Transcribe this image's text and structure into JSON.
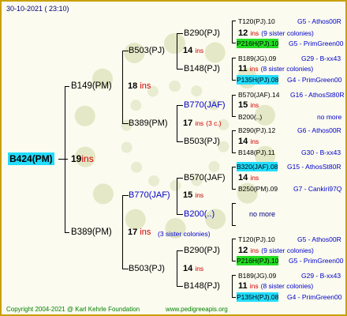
{
  "header": {
    "date_line": "30-10-2021 ( 23:10)"
  },
  "footer": {
    "copyright": "Copyright 2004-2021 @ Karl Kehrle Foundation",
    "site": "www.pedigreeapis.org"
  },
  "colors": {
    "frame": "#c8a000",
    "green_hl": "#22dd22",
    "cyan_hl": "#22ddff",
    "ins_red": "#d00000",
    "link_blue": "#0000cc"
  },
  "root": {
    "label": "B424(PM)",
    "gen": "19",
    "unit": "ins"
  },
  "g1": {
    "top": {
      "label": "B149(PM)",
      "gen": "18",
      "unit": "ins"
    },
    "bottom": {
      "label": "B389(PM)",
      "gen": "17",
      "unit": "ins",
      "note": "(3 sister colonies)"
    }
  },
  "g2": {
    "a": {
      "label": "B503(PJ)",
      "gen": "14",
      "unit": "ins"
    },
    "b": {
      "label": "B389(PM)",
      "gen": "17",
      "unit": "ins",
      "note": "(3 c.)"
    },
    "c": {
      "label": "B770(JAF)",
      "gen": "15",
      "unit": "ins"
    },
    "d": {
      "label": "B503(PJ)",
      "gen": "14",
      "unit": "ins"
    }
  },
  "g3": {
    "a1": {
      "label": "B290(PJ)",
      "gen": "12",
      "unit": "ins",
      "note": "(9 sister colonies)"
    },
    "a2": {
      "label": "B148(PJ)",
      "gen": "11",
      "unit": "ins",
      "note": "(8 sister colonies)"
    },
    "b1": {
      "label": "B770(JAF)",
      "gen": "15",
      "unit": "ins"
    },
    "b2": {
      "label": "B503(PJ)",
      "gen": "14",
      "unit": "ins"
    },
    "c1": {
      "label": "B570(JAF)",
      "gen": "14",
      "unit": "ins"
    },
    "c2": {
      "label": "B200(..)",
      "more": "no more"
    },
    "d1": {
      "label": "B290(PJ)",
      "gen": "12",
      "unit": "ins",
      "note": "(9 sister colonies)"
    },
    "d2": {
      "label": "B148(PJ)",
      "gen": "11",
      "unit": "ins",
      "note": "(8 sister colonies)"
    }
  },
  "g4": [
    {
      "name": "T120(PJ).10",
      "line": "G5 - Athos00R"
    },
    {
      "name": "P216H(PJ).10",
      "line": "G5 - PrimGreen00"
    },
    {
      "name": "B189(JG).09",
      "line": "G29 - B-xx43"
    },
    {
      "name": "P135H(PJ).08",
      "line": "G4 - PrimGreen00"
    },
    {
      "name": "B570(JAF).14",
      "line": "G16 - AthosSt80R"
    },
    {
      "name": "B200(..)",
      "line": "no more"
    },
    {
      "name": "B290(PJ).12",
      "line": "G6 - Athos00R"
    },
    {
      "name": "B148(PJ).11",
      "line": "G30 - B-xx43"
    },
    {
      "name": "B320(JAF).08",
      "line": "G15 - AthosSt80R"
    },
    {
      "name": "B250(PM).09",
      "line": "G7 - Cankiri97Q"
    },
    {
      "name": "T120(PJ).10",
      "line": "G5 - Athos00R"
    },
    {
      "name": "P216H(PJ).10",
      "line": "G5 - PrimGreen00"
    },
    {
      "name": "B189(JG).09",
      "line": "G29 - B-xx43"
    },
    {
      "name": "P135H(PJ).08",
      "line": "G4 - PrimGreen00"
    }
  ]
}
